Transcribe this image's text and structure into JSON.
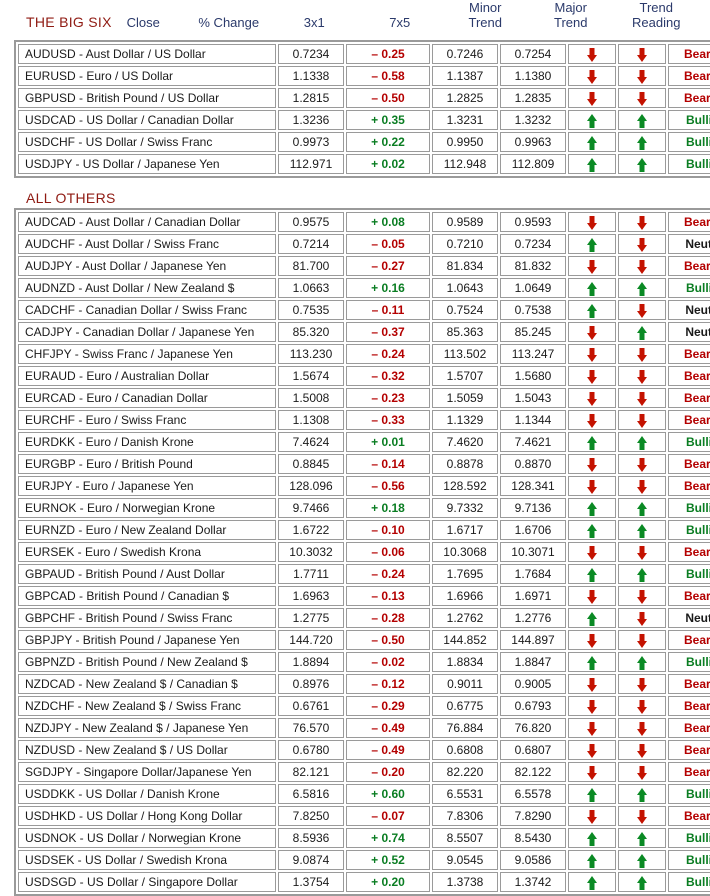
{
  "columns": {
    "pair": "",
    "close": "Close",
    "pct_change": "% Change",
    "m3x1": "3x1",
    "m7x5": "7x5",
    "minor_trend_line1": "Minor",
    "minor_trend_line2": "Trend",
    "major_trend_line1": "Major",
    "major_trend_line2": "Trend",
    "trend_reading_line1": "Trend",
    "trend_reading_line2": "Reading"
  },
  "sections": [
    {
      "title": "THE BIG SIX",
      "rows": [
        {
          "pair": "AUDUSD - Aust Dollar / US Dollar",
          "close": "0.7234",
          "change": "– 0.25",
          "change_dir": "down",
          "m3x1": "0.7246",
          "m7x5": "0.7254",
          "minor": "down",
          "major": "down",
          "reading": "Bearish"
        },
        {
          "pair": "EURUSD - Euro / US Dollar",
          "close": "1.1338",
          "change": "– 0.58",
          "change_dir": "down",
          "m3x1": "1.1387",
          "m7x5": "1.1380",
          "minor": "down",
          "major": "down",
          "reading": "Bearish"
        },
        {
          "pair": "GBPUSD - British Pound / US Dollar",
          "close": "1.2815",
          "change": "– 0.50",
          "change_dir": "down",
          "m3x1": "1.2825",
          "m7x5": "1.2835",
          "minor": "down",
          "major": "down",
          "reading": "Bearish"
        },
        {
          "pair": "USDCAD - US Dollar / Canadian Dollar",
          "close": "1.3236",
          "change": "+ 0.35",
          "change_dir": "up",
          "m3x1": "1.3231",
          "m7x5": "1.3232",
          "minor": "up",
          "major": "up",
          "reading": "Bullish"
        },
        {
          "pair": "USDCHF - US Dollar / Swiss Franc",
          "close": "0.9973",
          "change": "+ 0.22",
          "change_dir": "up",
          "m3x1": "0.9950",
          "m7x5": "0.9963",
          "minor": "up",
          "major": "up",
          "reading": "Bullish"
        },
        {
          "pair": "USDJPY - US Dollar / Japanese Yen",
          "close": "112.971",
          "change": "+ 0.02",
          "change_dir": "up",
          "m3x1": "112.948",
          "m7x5": "112.809",
          "minor": "up",
          "major": "up",
          "reading": "Bullish"
        }
      ]
    },
    {
      "title": "ALL OTHERS",
      "rows": [
        {
          "pair": "AUDCAD - Aust Dollar / Canadian Dollar",
          "close": "0.9575",
          "change": "+ 0.08",
          "change_dir": "up",
          "m3x1": "0.9589",
          "m7x5": "0.9593",
          "minor": "down",
          "major": "down",
          "reading": "Bearish"
        },
        {
          "pair": "AUDCHF - Aust Dollar / Swiss Franc",
          "close": "0.7214",
          "change": "– 0.05",
          "change_dir": "down",
          "m3x1": "0.7210",
          "m7x5": "0.7234",
          "minor": "up",
          "major": "down",
          "reading": "Neutral"
        },
        {
          "pair": "AUDJPY - Aust Dollar / Japanese Yen",
          "close": "81.700",
          "change": "– 0.27",
          "change_dir": "down",
          "m3x1": "81.834",
          "m7x5": "81.832",
          "minor": "down",
          "major": "down",
          "reading": "Bearish"
        },
        {
          "pair": "AUDNZD - Aust Dollar / New Zealand $",
          "close": "1.0663",
          "change": "+ 0.16",
          "change_dir": "up",
          "m3x1": "1.0643",
          "m7x5": "1.0649",
          "minor": "up",
          "major": "up",
          "reading": "Bullish"
        },
        {
          "pair": "CADCHF - Canadian Dollar / Swiss Franc",
          "close": "0.7535",
          "change": "– 0.11",
          "change_dir": "down",
          "m3x1": "0.7524",
          "m7x5": "0.7538",
          "minor": "up",
          "major": "down",
          "reading": "Neutral"
        },
        {
          "pair": "CADJPY - Canadian Dollar / Japanese Yen",
          "close": "85.320",
          "change": "– 0.37",
          "change_dir": "down",
          "m3x1": "85.363",
          "m7x5": "85.245",
          "minor": "down",
          "major": "up",
          "reading": "Neutral"
        },
        {
          "pair": "CHFJPY - Swiss Franc / Japanese Yen",
          "close": "113.230",
          "change": "– 0.24",
          "change_dir": "down",
          "m3x1": "113.502",
          "m7x5": "113.247",
          "minor": "down",
          "major": "down",
          "reading": "Bearish"
        },
        {
          "pair": "EURAUD - Euro / Australian Dollar",
          "close": "1.5674",
          "change": "– 0.32",
          "change_dir": "down",
          "m3x1": "1.5707",
          "m7x5": "1.5680",
          "minor": "down",
          "major": "down",
          "reading": "Bearish"
        },
        {
          "pair": "EURCAD - Euro / Canadian Dollar",
          "close": "1.5008",
          "change": "– 0.23",
          "change_dir": "down",
          "m3x1": "1.5059",
          "m7x5": "1.5043",
          "minor": "down",
          "major": "down",
          "reading": "Bearish"
        },
        {
          "pair": "EURCHF - Euro / Swiss Franc",
          "close": "1.1308",
          "change": "– 0.33",
          "change_dir": "down",
          "m3x1": "1.1329",
          "m7x5": "1.1344",
          "minor": "down",
          "major": "down",
          "reading": "Bearish"
        },
        {
          "pair": "EURDKK - Euro / Danish Krone",
          "close": "7.4624",
          "change": "+ 0.01",
          "change_dir": "up",
          "m3x1": "7.4620",
          "m7x5": "7.4621",
          "minor": "up",
          "major": "up",
          "reading": "Bullish"
        },
        {
          "pair": "EURGBP - Euro / British Pound",
          "close": "0.8845",
          "change": "– 0.14",
          "change_dir": "down",
          "m3x1": "0.8878",
          "m7x5": "0.8870",
          "minor": "down",
          "major": "down",
          "reading": "Bearish"
        },
        {
          "pair": "EURJPY - Euro / Japanese Yen",
          "close": "128.096",
          "change": "– 0.56",
          "change_dir": "down",
          "m3x1": "128.592",
          "m7x5": "128.341",
          "minor": "down",
          "major": "down",
          "reading": "Bearish"
        },
        {
          "pair": "EURNOK - Euro / Norwegian Krone",
          "close": "9.7466",
          "change": "+ 0.18",
          "change_dir": "up",
          "m3x1": "9.7332",
          "m7x5": "9.7136",
          "minor": "up",
          "major": "up",
          "reading": "Bullish"
        },
        {
          "pair": "EURNZD - Euro / New Zealand Dollar",
          "close": "1.6722",
          "change": "– 0.10",
          "change_dir": "down",
          "m3x1": "1.6717",
          "m7x5": "1.6706",
          "minor": "up",
          "major": "up",
          "reading": "Bullish"
        },
        {
          "pair": "EURSEK - Euro / Swedish Krona",
          "close": "10.3032",
          "change": "– 0.06",
          "change_dir": "down",
          "m3x1": "10.3068",
          "m7x5": "10.3071",
          "minor": "down",
          "major": "down",
          "reading": "Bearish"
        },
        {
          "pair": "GBPAUD - British Pound / Aust Dollar",
          "close": "1.7711",
          "change": "– 0.24",
          "change_dir": "down",
          "m3x1": "1.7695",
          "m7x5": "1.7684",
          "minor": "up",
          "major": "up",
          "reading": "Bullish"
        },
        {
          "pair": "GBPCAD - British Pound / Canadian $",
          "close": "1.6963",
          "change": "– 0.13",
          "change_dir": "down",
          "m3x1": "1.6966",
          "m7x5": "1.6971",
          "minor": "down",
          "major": "down",
          "reading": "Bearish"
        },
        {
          "pair": "GBPCHF - British Pound / Swiss Franc",
          "close": "1.2775",
          "change": "– 0.28",
          "change_dir": "down",
          "m3x1": "1.2762",
          "m7x5": "1.2776",
          "minor": "up",
          "major": "down",
          "reading": "Neutral"
        },
        {
          "pair": "GBPJPY - British Pound / Japanese Yen",
          "close": "144.720",
          "change": "– 0.50",
          "change_dir": "down",
          "m3x1": "144.852",
          "m7x5": "144.897",
          "minor": "down",
          "major": "down",
          "reading": "Bearish"
        },
        {
          "pair": "GBPNZD - British Pound / New Zealand $",
          "close": "1.8894",
          "change": "– 0.02",
          "change_dir": "down",
          "m3x1": "1.8834",
          "m7x5": "1.8847",
          "minor": "up",
          "major": "up",
          "reading": "Bullish"
        },
        {
          "pair": "NZDCAD - New Zealand $ / Canadian $",
          "close": "0.8976",
          "change": "– 0.12",
          "change_dir": "down",
          "m3x1": "0.9011",
          "m7x5": "0.9005",
          "minor": "down",
          "major": "down",
          "reading": "Bearish"
        },
        {
          "pair": "NZDCHF - New Zealand $ / Swiss Franc",
          "close": "0.6761",
          "change": "– 0.29",
          "change_dir": "down",
          "m3x1": "0.6775",
          "m7x5": "0.6793",
          "minor": "down",
          "major": "down",
          "reading": "Bearish"
        },
        {
          "pair": "NZDJPY - New Zealand $ / Japanese Yen",
          "close": "76.570",
          "change": "– 0.49",
          "change_dir": "down",
          "m3x1": "76.884",
          "m7x5": "76.820",
          "minor": "down",
          "major": "down",
          "reading": "Bearish"
        },
        {
          "pair": "NZDUSD - New Zealand $ / US Dollar",
          "close": "0.6780",
          "change": "– 0.49",
          "change_dir": "down",
          "m3x1": "0.6808",
          "m7x5": "0.6807",
          "minor": "down",
          "major": "down",
          "reading": "Bearish"
        },
        {
          "pair": "SGDJPY - Singapore Dollar/Japanese Yen",
          "close": "82.121",
          "change": "– 0.20",
          "change_dir": "down",
          "m3x1": "82.220",
          "m7x5": "82.122",
          "minor": "down",
          "major": "down",
          "reading": "Bearish"
        },
        {
          "pair": "USDDKK - US Dollar / Danish Krone",
          "close": "6.5816",
          "change": "+ 0.60",
          "change_dir": "up",
          "m3x1": "6.5531",
          "m7x5": "6.5578",
          "minor": "up",
          "major": "up",
          "reading": "Bullish"
        },
        {
          "pair": "USDHKD - US Dollar / Hong Kong Dollar",
          "close": "7.8250",
          "change": "– 0.07",
          "change_dir": "down",
          "m3x1": "7.8306",
          "m7x5": "7.8290",
          "minor": "down",
          "major": "down",
          "reading": "Bearish"
        },
        {
          "pair": "USDNOK - US Dollar / Norwegian Krone",
          "close": "8.5936",
          "change": "+ 0.74",
          "change_dir": "up",
          "m3x1": "8.5507",
          "m7x5": "8.5430",
          "minor": "up",
          "major": "up",
          "reading": "Bullish"
        },
        {
          "pair": "USDSEK - US Dollar / Swedish Krona",
          "close": "9.0874",
          "change": "+ 0.52",
          "change_dir": "up",
          "m3x1": "9.0545",
          "m7x5": "9.0586",
          "minor": "up",
          "major": "up",
          "reading": "Bullish"
        },
        {
          "pair": "USDSGD - US Dollar / Singapore Dollar",
          "close": "1.3754",
          "change": "+ 0.20",
          "change_dir": "up",
          "m3x1": "1.3738",
          "m7x5": "1.3742",
          "minor": "up",
          "major": "up",
          "reading": "Bullish"
        }
      ]
    }
  ],
  "colors": {
    "section_title": "#8f1a12",
    "header_text": "#2b3a6b",
    "bullish": "#0a7d22",
    "bearish": "#b40000",
    "neutral": "#1a1a1a",
    "arrow_up": "#0a8a24",
    "arrow_down": "#c41200",
    "border": "#9a9a9a"
  }
}
